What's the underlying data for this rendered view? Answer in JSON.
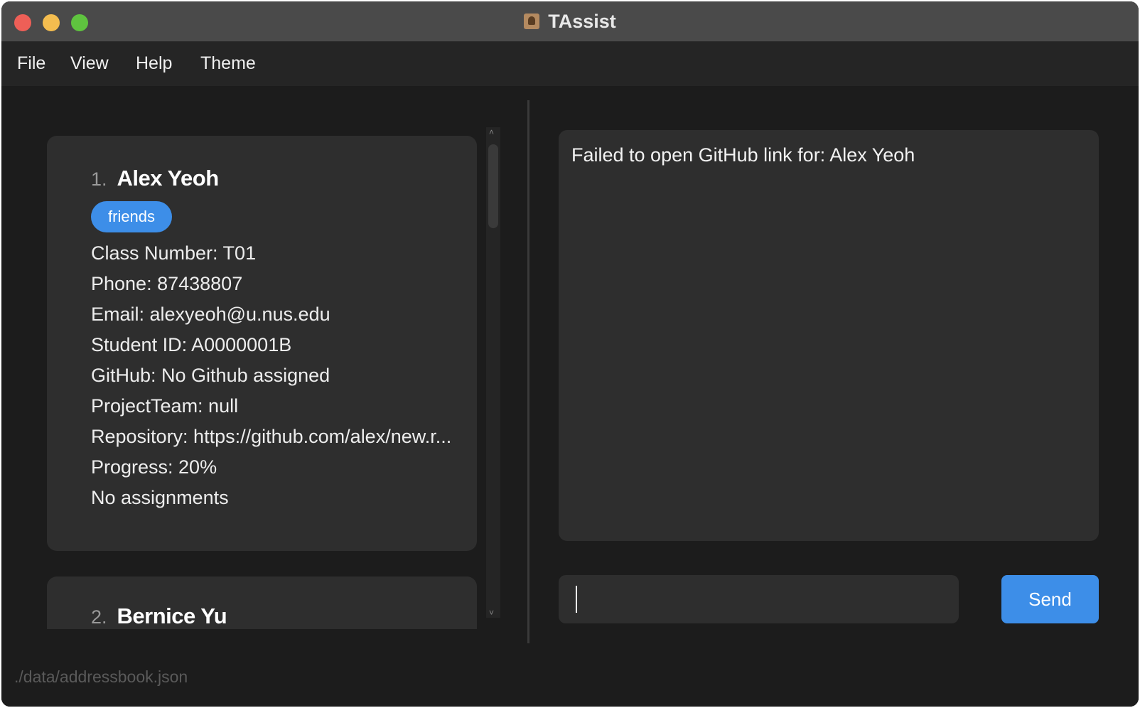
{
  "window": {
    "title": "TAssist"
  },
  "menu": {
    "items": [
      "File",
      "View",
      "Help",
      "Theme"
    ]
  },
  "persons": [
    {
      "index": "1.",
      "name": "Alex Yeoh",
      "tags": [
        "friends"
      ],
      "fields": [
        "Class Number: T01",
        "Phone: 87438807",
        "Email: alexyeoh@u.nus.edu",
        "Student ID: A0000001B",
        "GitHub: No Github assigned",
        "ProjectTeam: null",
        "Repository: https://github.com/alex/new.r...",
        "Progress: 20%",
        "No assignments"
      ]
    },
    {
      "index": "2.",
      "name": "Bernice Yu"
    }
  ],
  "result": {
    "message": "Failed to open GitHub link for: Alex Yeoh"
  },
  "command": {
    "value": "",
    "send_label": "Send"
  },
  "status": {
    "path": "./data/addressbook.json"
  },
  "colors": {
    "accent": "#3d8ee8",
    "background": "#1c1c1c",
    "panel": "#2e2e2e"
  }
}
